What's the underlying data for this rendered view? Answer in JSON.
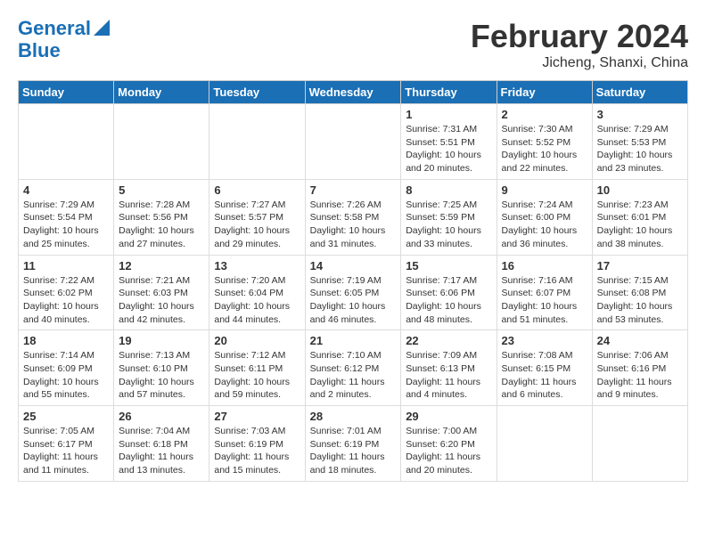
{
  "header": {
    "logo_line1": "General",
    "logo_line2": "Blue",
    "title": "February 2024",
    "subtitle": "Jicheng, Shanxi, China"
  },
  "days_of_week": [
    "Sunday",
    "Monday",
    "Tuesday",
    "Wednesday",
    "Thursday",
    "Friday",
    "Saturday"
  ],
  "weeks": [
    [
      {
        "day": "",
        "info": ""
      },
      {
        "day": "",
        "info": ""
      },
      {
        "day": "",
        "info": ""
      },
      {
        "day": "",
        "info": ""
      },
      {
        "day": "1",
        "info": "Sunrise: 7:31 AM\nSunset: 5:51 PM\nDaylight: 10 hours\nand 20 minutes."
      },
      {
        "day": "2",
        "info": "Sunrise: 7:30 AM\nSunset: 5:52 PM\nDaylight: 10 hours\nand 22 minutes."
      },
      {
        "day": "3",
        "info": "Sunrise: 7:29 AM\nSunset: 5:53 PM\nDaylight: 10 hours\nand 23 minutes."
      }
    ],
    [
      {
        "day": "4",
        "info": "Sunrise: 7:29 AM\nSunset: 5:54 PM\nDaylight: 10 hours\nand 25 minutes."
      },
      {
        "day": "5",
        "info": "Sunrise: 7:28 AM\nSunset: 5:56 PM\nDaylight: 10 hours\nand 27 minutes."
      },
      {
        "day": "6",
        "info": "Sunrise: 7:27 AM\nSunset: 5:57 PM\nDaylight: 10 hours\nand 29 minutes."
      },
      {
        "day": "7",
        "info": "Sunrise: 7:26 AM\nSunset: 5:58 PM\nDaylight: 10 hours\nand 31 minutes."
      },
      {
        "day": "8",
        "info": "Sunrise: 7:25 AM\nSunset: 5:59 PM\nDaylight: 10 hours\nand 33 minutes."
      },
      {
        "day": "9",
        "info": "Sunrise: 7:24 AM\nSunset: 6:00 PM\nDaylight: 10 hours\nand 36 minutes."
      },
      {
        "day": "10",
        "info": "Sunrise: 7:23 AM\nSunset: 6:01 PM\nDaylight: 10 hours\nand 38 minutes."
      }
    ],
    [
      {
        "day": "11",
        "info": "Sunrise: 7:22 AM\nSunset: 6:02 PM\nDaylight: 10 hours\nand 40 minutes."
      },
      {
        "day": "12",
        "info": "Sunrise: 7:21 AM\nSunset: 6:03 PM\nDaylight: 10 hours\nand 42 minutes."
      },
      {
        "day": "13",
        "info": "Sunrise: 7:20 AM\nSunset: 6:04 PM\nDaylight: 10 hours\nand 44 minutes."
      },
      {
        "day": "14",
        "info": "Sunrise: 7:19 AM\nSunset: 6:05 PM\nDaylight: 10 hours\nand 46 minutes."
      },
      {
        "day": "15",
        "info": "Sunrise: 7:17 AM\nSunset: 6:06 PM\nDaylight: 10 hours\nand 48 minutes."
      },
      {
        "day": "16",
        "info": "Sunrise: 7:16 AM\nSunset: 6:07 PM\nDaylight: 10 hours\nand 51 minutes."
      },
      {
        "day": "17",
        "info": "Sunrise: 7:15 AM\nSunset: 6:08 PM\nDaylight: 10 hours\nand 53 minutes."
      }
    ],
    [
      {
        "day": "18",
        "info": "Sunrise: 7:14 AM\nSunset: 6:09 PM\nDaylight: 10 hours\nand 55 minutes."
      },
      {
        "day": "19",
        "info": "Sunrise: 7:13 AM\nSunset: 6:10 PM\nDaylight: 10 hours\nand 57 minutes."
      },
      {
        "day": "20",
        "info": "Sunrise: 7:12 AM\nSunset: 6:11 PM\nDaylight: 10 hours\nand 59 minutes."
      },
      {
        "day": "21",
        "info": "Sunrise: 7:10 AM\nSunset: 6:12 PM\nDaylight: 11 hours\nand 2 minutes."
      },
      {
        "day": "22",
        "info": "Sunrise: 7:09 AM\nSunset: 6:13 PM\nDaylight: 11 hours\nand 4 minutes."
      },
      {
        "day": "23",
        "info": "Sunrise: 7:08 AM\nSunset: 6:15 PM\nDaylight: 11 hours\nand 6 minutes."
      },
      {
        "day": "24",
        "info": "Sunrise: 7:06 AM\nSunset: 6:16 PM\nDaylight: 11 hours\nand 9 minutes."
      }
    ],
    [
      {
        "day": "25",
        "info": "Sunrise: 7:05 AM\nSunset: 6:17 PM\nDaylight: 11 hours\nand 11 minutes."
      },
      {
        "day": "26",
        "info": "Sunrise: 7:04 AM\nSunset: 6:18 PM\nDaylight: 11 hours\nand 13 minutes."
      },
      {
        "day": "27",
        "info": "Sunrise: 7:03 AM\nSunset: 6:19 PM\nDaylight: 11 hours\nand 15 minutes."
      },
      {
        "day": "28",
        "info": "Sunrise: 7:01 AM\nSunset: 6:19 PM\nDaylight: 11 hours\nand 18 minutes."
      },
      {
        "day": "29",
        "info": "Sunrise: 7:00 AM\nSunset: 6:20 PM\nDaylight: 11 hours\nand 20 minutes."
      },
      {
        "day": "",
        "info": ""
      },
      {
        "day": "",
        "info": ""
      }
    ]
  ]
}
